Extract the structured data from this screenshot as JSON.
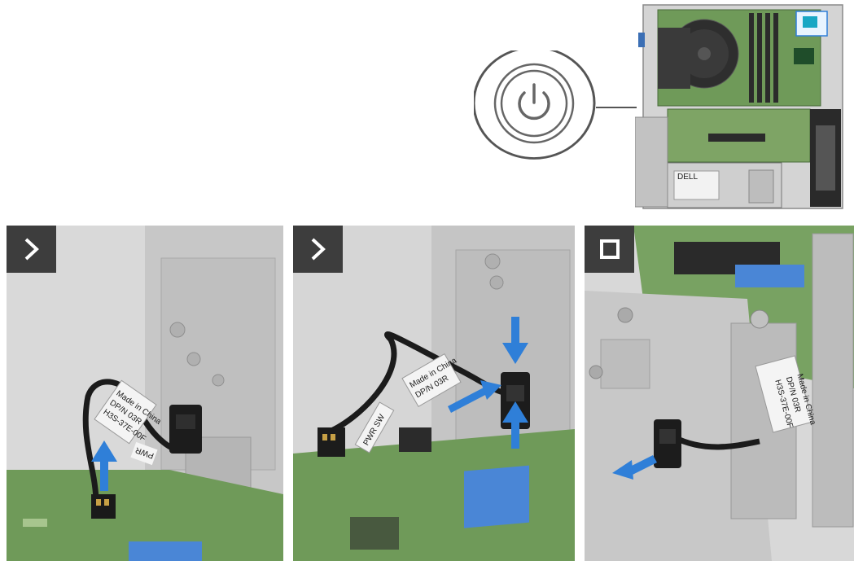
{
  "steps": [
    {
      "badge": "chevron-right-icon"
    },
    {
      "badge": "chevron-right-icon"
    },
    {
      "badge": "stop-square-icon"
    }
  ],
  "labels": {
    "cable_label": "PWR",
    "cable_label_alt": "PWR SW",
    "made_in": "Made in China",
    "dpn": "DP/N 03R",
    "part_code": "H3S-37E-00F"
  },
  "colors": {
    "step_badge": "#3d3d3d",
    "arrow": "#2f7fd8",
    "board": "#6f9a59",
    "chassis": "#c9c9c9"
  }
}
